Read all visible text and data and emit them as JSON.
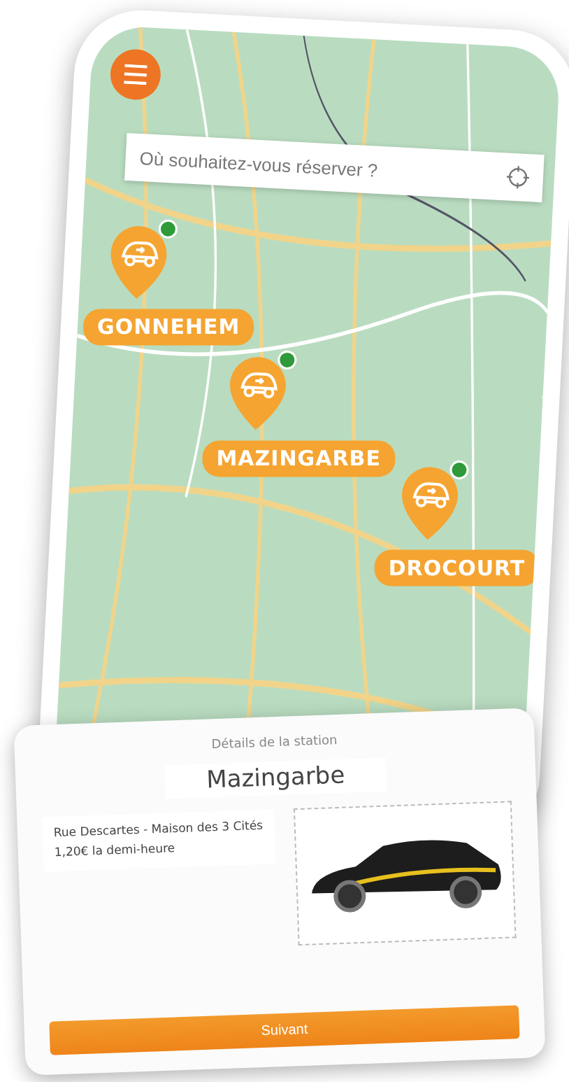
{
  "search": {
    "placeholder": "Où souhaitez-vous réserver ?"
  },
  "stations": [
    {
      "name": "GONNEHEM",
      "available": true
    },
    {
      "name": "MAZINGARBE",
      "available": true
    },
    {
      "name": "DROCOURT",
      "available": true
    }
  ],
  "details": {
    "heading": "Détails de la station",
    "title": "Mazingarbe",
    "address": "Rue Descartes - Maison des 3 Cités",
    "price": "1,20€ la demi-heure",
    "button": "Suivant"
  }
}
